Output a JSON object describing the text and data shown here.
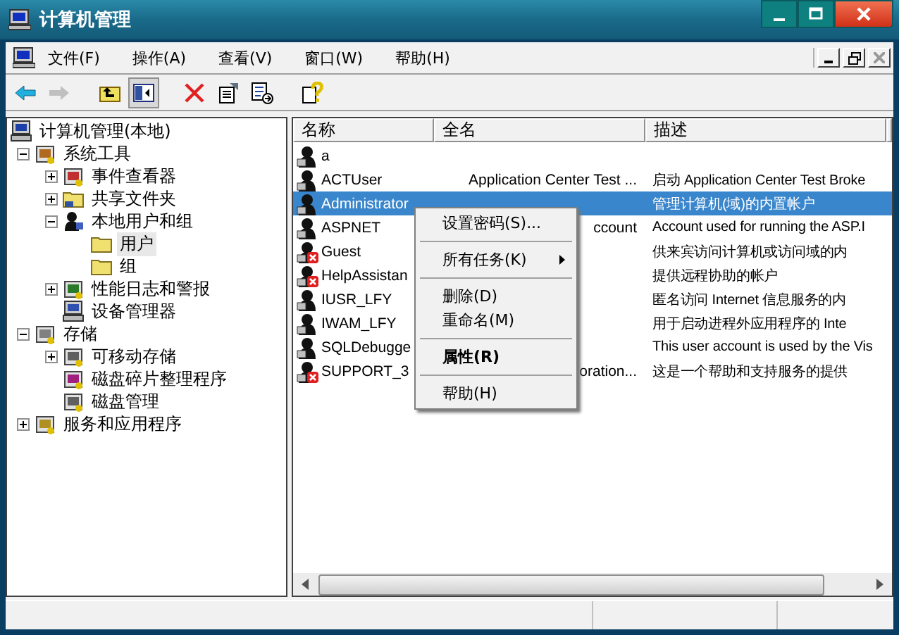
{
  "window": {
    "title": "计算机管理"
  },
  "menu_bar": [
    "文件(F)",
    "操作(A)",
    "查看(V)",
    "窗口(W)",
    "帮助(H)"
  ],
  "toolbar": [
    {
      "kind": "back",
      "disabled": false,
      "selected": false
    },
    {
      "kind": "forward",
      "disabled": true,
      "selected": false
    },
    {
      "kind": "up",
      "disabled": false,
      "selected": false
    },
    {
      "kind": "tree",
      "disabled": false,
      "selected": true
    },
    {
      "kind": "delete",
      "disabled": false,
      "selected": false
    },
    {
      "kind": "properties",
      "disabled": false,
      "selected": false
    },
    {
      "kind": "export",
      "disabled": false,
      "selected": false
    },
    {
      "kind": "help",
      "disabled": false,
      "selected": false
    }
  ],
  "tree": [
    {
      "label": "计算机管理(本地)",
      "kind": "computer",
      "selected": false,
      "children": [
        {
          "label": "系统工具",
          "kind": "tools",
          "expanded": true,
          "selected": false,
          "children": [
            {
              "label": "事件查看器",
              "kind": "events",
              "expanded": false,
              "selected": false
            },
            {
              "label": "共享文件夹",
              "kind": "share",
              "expanded": false,
              "selected": false
            },
            {
              "label": "本地用户和组",
              "kind": "users",
              "expanded": true,
              "selected": false,
              "children": [
                {
                  "label": "用户",
                  "kind": "folder",
                  "selected": true
                },
                {
                  "label": "组",
                  "kind": "folder",
                  "selected": false
                }
              ]
            },
            {
              "label": "性能日志和警报",
              "kind": "chart",
              "expanded": false,
              "selected": false
            },
            {
              "label": "设备管理器",
              "kind": "device",
              "selected": false
            }
          ]
        },
        {
          "label": "存储",
          "kind": "storage",
          "expanded": true,
          "selected": false,
          "children": [
            {
              "label": "可移动存储",
              "kind": "disk",
              "expanded": false,
              "selected": false
            },
            {
              "label": "磁盘碎片整理程序",
              "kind": "defrag",
              "selected": false
            },
            {
              "label": "磁盘管理",
              "kind": "disk",
              "selected": false
            }
          ]
        },
        {
          "label": "服务和应用程序",
          "kind": "services",
          "expanded": false,
          "selected": false
        }
      ]
    }
  ],
  "table": {
    "columns": [
      "名称",
      "全名",
      "描述"
    ],
    "rows": [
      {
        "name": "a",
        "disabled": false,
        "selected": false
      },
      {
        "name": "ACTUser",
        "full_name": "Application Center Test ...",
        "description": "启动 Application Center Test Broke",
        "disabled": false,
        "selected": false
      },
      {
        "name": "Administrator",
        "description": "管理计算机(域)的内置帐户",
        "disabled": false,
        "selected": true
      },
      {
        "name": "ASPNET",
        "full_name": "ccount",
        "description": "Account used for running the ASP.I",
        "disabled": false,
        "selected": false
      },
      {
        "name": "Guest",
        "description": "供来宾访问计算机或访问域的内",
        "disabled": true,
        "selected": false
      },
      {
        "name": "HelpAssistan",
        "description": "提供远程协助的帐户",
        "disabled": true,
        "selected": false
      },
      {
        "name": "IUSR_LFY",
        "description": "匿名访问 Internet 信息服务的内",
        "disabled": false,
        "selected": false
      },
      {
        "name": "IWAM_LFY",
        "description": "用于启动进程外应用程序的 Inte",
        "disabled": false,
        "selected": false
      },
      {
        "name": "SQLDebugge",
        "description": "This user account is used by the Vis",
        "disabled": false,
        "selected": false
      },
      {
        "name": "SUPPORT_3",
        "full_name": "oration...",
        "description": "这是一个帮助和支持服务的提供",
        "disabled": true,
        "selected": false
      }
    ]
  },
  "context_menu": [
    {
      "kind": "item",
      "label": "设置密码(S)...",
      "bold": false,
      "submenu": false
    },
    {
      "kind": "separator"
    },
    {
      "kind": "item",
      "label": "所有任务(K)",
      "bold": false,
      "submenu": true
    },
    {
      "kind": "separator"
    },
    {
      "kind": "item",
      "label": "删除(D)",
      "bold": false,
      "submenu": false
    },
    {
      "kind": "item",
      "label": "重命名(M)",
      "bold": false,
      "submenu": false
    },
    {
      "kind": "separator"
    },
    {
      "kind": "item",
      "label": "属性(R)",
      "bold": true,
      "submenu": false
    },
    {
      "kind": "separator"
    },
    {
      "kind": "item",
      "label": "帮助(H)",
      "bold": false,
      "submenu": false
    }
  ]
}
